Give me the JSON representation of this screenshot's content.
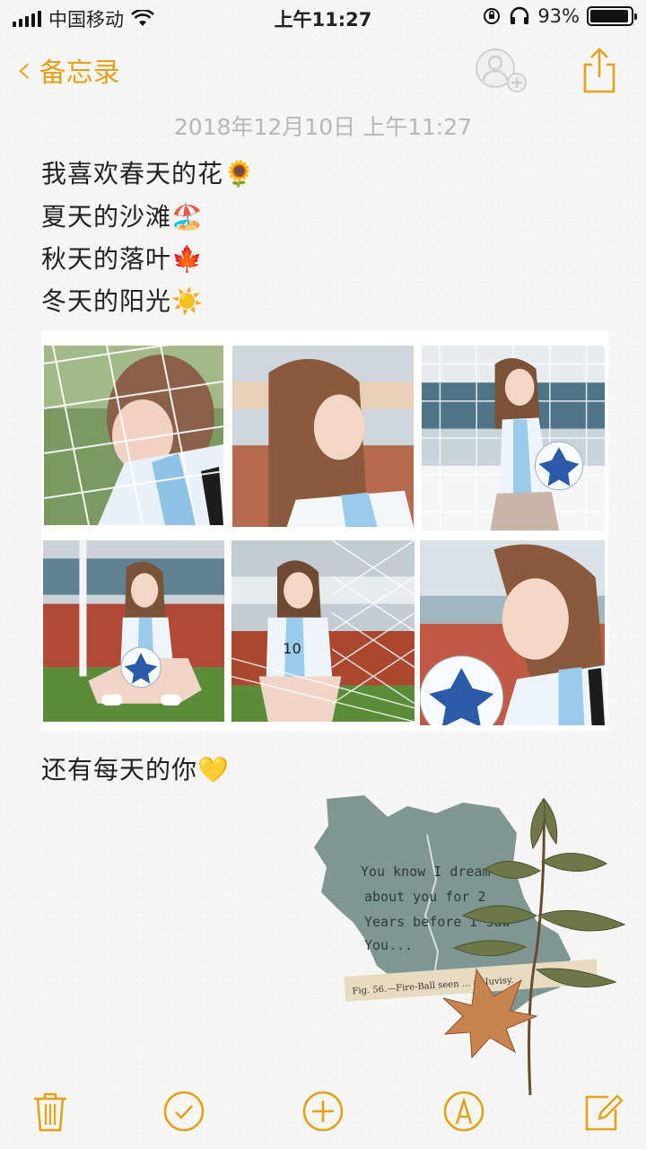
{
  "status_bar": {
    "carrier": "中国移动",
    "time": "上午11:27",
    "battery": "93%"
  },
  "nav": {
    "back_label": "备忘录"
  },
  "note": {
    "date": "2018年12月10日 上午11:27",
    "lines": [
      "我喜欢春天的花🌻",
      "夏天的沙滩🏖️",
      "秋天的落叶🍁",
      "冬天的阳光☀️"
    ],
    "closing": "还有每天的你💛"
  },
  "sticker": {
    "handwriting": [
      "You know I dream",
      "about you for 2",
      "Years before I saw",
      "You..."
    ],
    "clipping": "Fig. 56.—Fire-Ball seen ... at Juvisy."
  },
  "colors": {
    "accent": "#e3a21b",
    "date_gray": "#b7b7b7"
  },
  "icons": {
    "toolbar": [
      "trash-icon",
      "checklist-icon",
      "add-icon",
      "markup-icon",
      "compose-icon"
    ]
  }
}
